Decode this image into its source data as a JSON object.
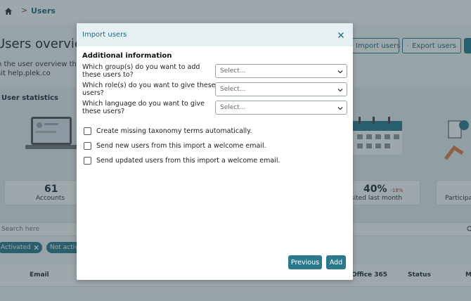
{
  "breadcrumb": {
    "current": "Users",
    "separator": ">"
  },
  "page": {
    "title": "Users overview",
    "intro_line1": "n the user overview there",
    "intro_line2": "sit help.plek.co",
    "header_buttons": {
      "import": "Import users",
      "export": "Export users"
    }
  },
  "stats": {
    "title": "User statistics",
    "accounts": {
      "value": "61",
      "label": "Accounts"
    },
    "visited": {
      "value": "40%",
      "delta": "-18%",
      "label": "sited last month"
    },
    "participation": {
      "label": "Participa"
    }
  },
  "search": {
    "placeholder": "Search here"
  },
  "filters": {
    "activated": "Activated",
    "not_activated": "Not activ"
  },
  "table": {
    "columns": [
      "Email",
      "Office 365",
      "Status",
      "M"
    ]
  },
  "modal": {
    "title": "Import users",
    "section_title": "Additional information",
    "questions": [
      {
        "label": "Which group(s) do you want to add these users to?",
        "value": "Select..."
      },
      {
        "label": "Which role(s) do you want to give these users?",
        "value": "Select..."
      },
      {
        "label": "Which language do you want to give these users?",
        "value": "Select..."
      }
    ],
    "checkboxes": [
      {
        "label": "Create missing taxonomy terms automatically.",
        "checked": false
      },
      {
        "label": "Send new users from this import a welcome email.",
        "checked": false
      },
      {
        "label": "Send updated users from this import a welcome email.",
        "checked": false
      }
    ],
    "buttons": {
      "previous": "Previous",
      "add": "Add"
    }
  },
  "colors": {
    "accent": "#2a7a8c",
    "header_bg": "#e6f0f2",
    "overlay": "rgba(40,60,70,0.45)"
  },
  "icons": [
    "home-icon",
    "close-icon",
    "chevron-down-icon",
    "import-icon",
    "export-icon",
    "search-icon"
  ]
}
